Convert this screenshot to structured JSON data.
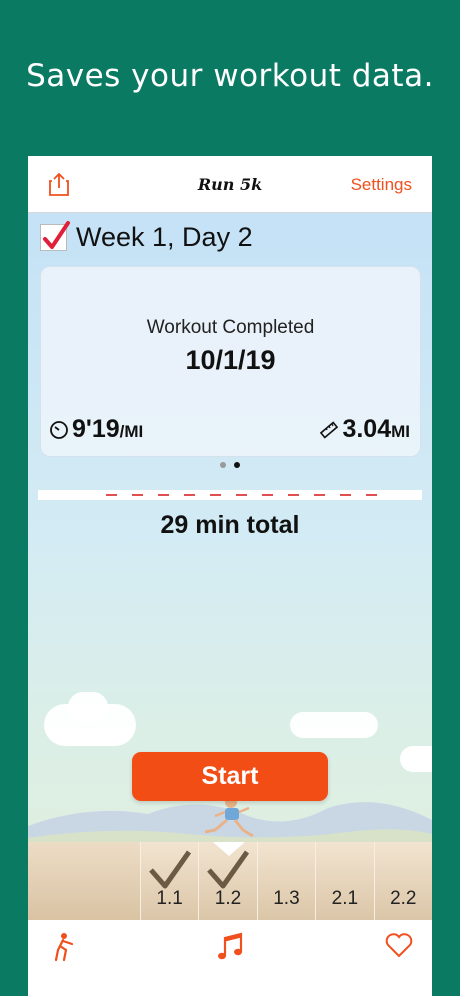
{
  "headline": "Saves your workout data.",
  "nav": {
    "title": "Run 5k",
    "settings_label": "Settings",
    "share_icon": "share-icon"
  },
  "workout": {
    "week_title": "Week 1, Day 2",
    "completed": true,
    "card_caption": "Workout Completed",
    "date": "10/1/19",
    "pace_value": "9'19",
    "pace_unit": "/MI",
    "distance_value": "3.04",
    "distance_unit": "MI"
  },
  "pager": {
    "count": 2,
    "active_index": 1
  },
  "total_label": "29 min total",
  "start_label": "Start",
  "segments": [
    {
      "label": "1.1",
      "done": true
    },
    {
      "label": "1.2",
      "done": true,
      "current": true
    },
    {
      "label": "1.3",
      "done": false
    },
    {
      "label": "2.1",
      "done": false
    },
    {
      "label": "2.2",
      "done": false
    }
  ],
  "tabs": [
    {
      "name": "stretch-icon"
    },
    {
      "name": "music-icon"
    },
    {
      "name": "heart-icon"
    }
  ],
  "colors": {
    "background": "#0b7a63",
    "accent": "#f24d15",
    "settings_text": "#f0501e",
    "check": "#e0203a"
  }
}
